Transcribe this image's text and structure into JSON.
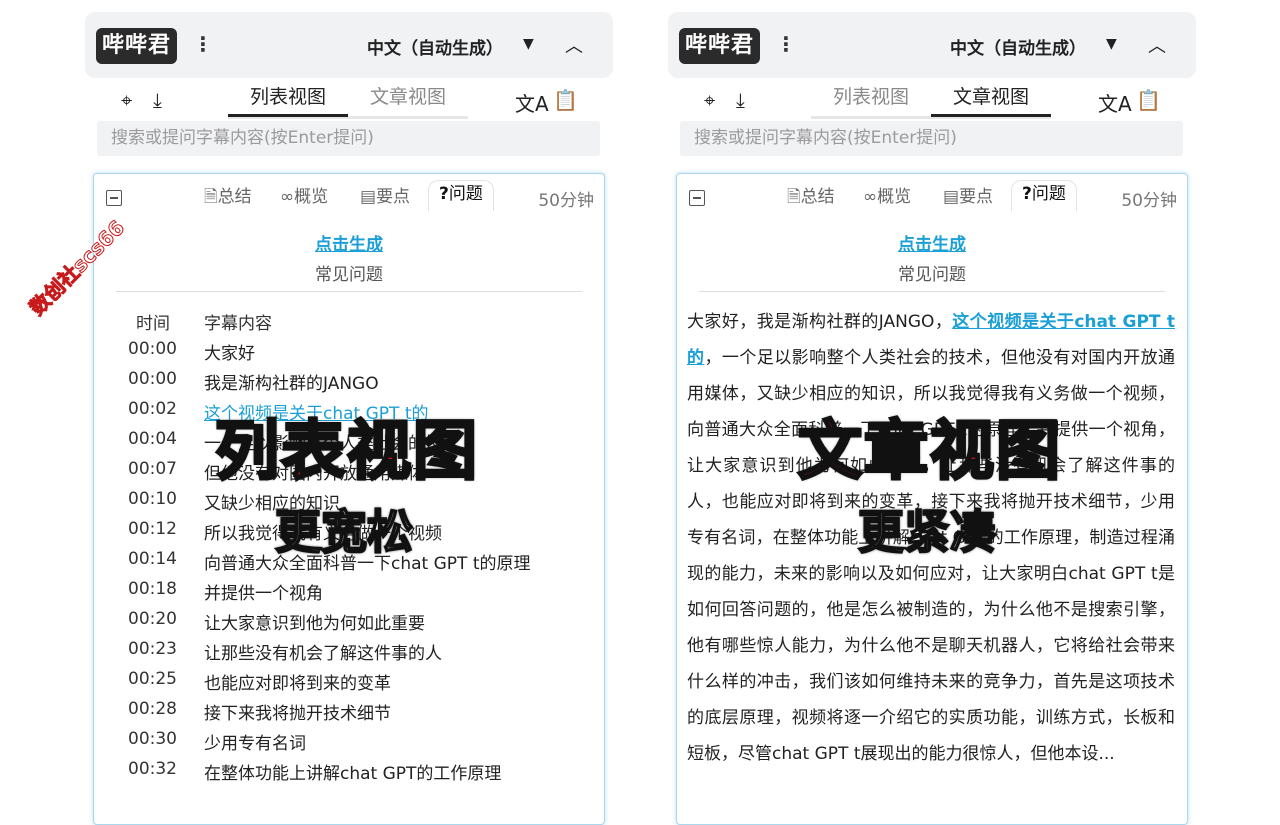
{
  "app": {
    "logo": "哔哔君",
    "language": "中文（自动生成）"
  },
  "toolbar": {
    "list_view": "列表视图",
    "article_view": "文章视图"
  },
  "search": {
    "placeholder": "搜索或提问字幕内容(按Enter提问)"
  },
  "card": {
    "tabs": [
      "总结",
      "概览",
      "要点",
      "问题"
    ],
    "tab_icons": [
      "document-icon",
      "binoculars-icon",
      "clipboard-icon",
      "question-icon"
    ],
    "active_tab": "问题",
    "duration": "50分钟",
    "generate_link": "点击生成",
    "faq_label": "常见问题"
  },
  "list": {
    "col_time": "时间",
    "col_content": "字幕内容",
    "rows": [
      {
        "time": "00:00",
        "text": "大家好"
      },
      {
        "time": "00:00",
        "text": "我是渐构社群的JANGO"
      },
      {
        "time": "00:02",
        "text": "这个视频是关于chat GPT t的",
        "highlight": true
      },
      {
        "time": "00:04",
        "text": "一个足以影响整个人类社会的技术"
      },
      {
        "time": "00:07",
        "text": "但他没有对国内开放通用媒体"
      },
      {
        "time": "00:10",
        "text": "又缺少相应的知识"
      },
      {
        "time": "00:12",
        "text": "所以我觉得我有义务做一个视频"
      },
      {
        "time": "00:14",
        "text": "向普通大众全面科普一下chat GPT t的原理"
      },
      {
        "time": "00:18",
        "text": "并提供一个视角"
      },
      {
        "time": "00:20",
        "text": "让大家意识到他为何如此重要"
      },
      {
        "time": "00:23",
        "text": "让那些没有机会了解这件事的人"
      },
      {
        "time": "00:25",
        "text": "也能应对即将到来的变革"
      },
      {
        "time": "00:28",
        "text": "接下来我将抛开技术细节"
      },
      {
        "time": "00:30",
        "text": "少用专有名词"
      },
      {
        "time": "00:32",
        "text": "在整体功能上讲解chat GPT的工作原理"
      }
    ]
  },
  "article": {
    "intro": "大家好，我是渐构社群的JANGO，",
    "link": "这个视频是关于chat GPT t的",
    "body": "，一个足以影响整个人类社会的技术，但他没有对国内开放通用媒体，又缺少相应的知识，所以我觉得我有义务做一个视频，向普通大众全面科普一下chat GPT t的原理，并提供一个视角，让大家意识到他为何如此重要，让那些没有机会了解这件事的人，也能应对即将到来的变革，接下来我将抛开技术细节，少用专有名词，在整体功能上讲解chat GPT的工作原理，制造过程涌现的能力，未来的影响以及如何应对，让大家明白chat GPT t是如何回答问题的，他是怎么被制造的，为什么他不是搜索引擎，他有哪些惊人能力，为什么他不是聊天机器人，它将给社会带来什么样的冲击，我们该如何维持未来的竞争力，首先是这项技术的底层原理，视频将逐一介绍它的实质功能，训练方式，长板和短板，尽管chat GPT t展现出的能力很惊人，但他本设..."
  },
  "overlays": {
    "left_title": "列表视图",
    "left_sub": "更宽松",
    "right_title": "文章视图",
    "right_sub": "更紧凑",
    "watermark": "数创社scs66"
  },
  "colors": {
    "accent": "#1a9fd6",
    "overlay_red": "#e3141c"
  }
}
